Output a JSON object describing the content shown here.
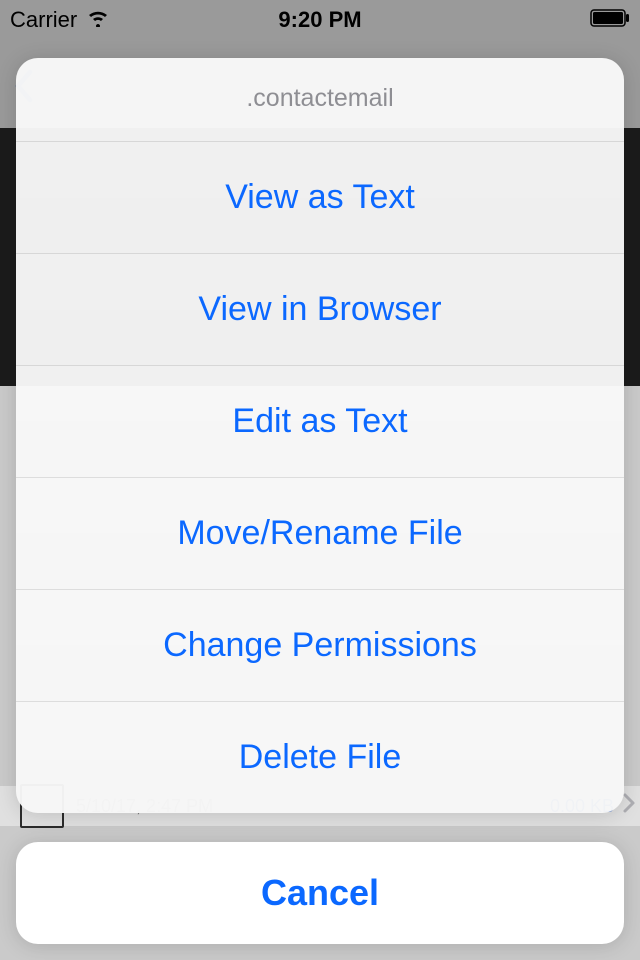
{
  "status_bar": {
    "carrier": "Carrier",
    "time": "9:20 PM"
  },
  "peek_row": {
    "date": "5/10/17, 2:47 PM",
    "size": "0.00 KB"
  },
  "sheet": {
    "title": ".contactemail",
    "items": [
      {
        "label": "View as Text"
      },
      {
        "label": "View in Browser"
      },
      {
        "label": "Edit as Text"
      },
      {
        "label": "Move/Rename File"
      },
      {
        "label": "Change Permissions"
      },
      {
        "label": "Delete File"
      }
    ],
    "cancel": "Cancel"
  }
}
